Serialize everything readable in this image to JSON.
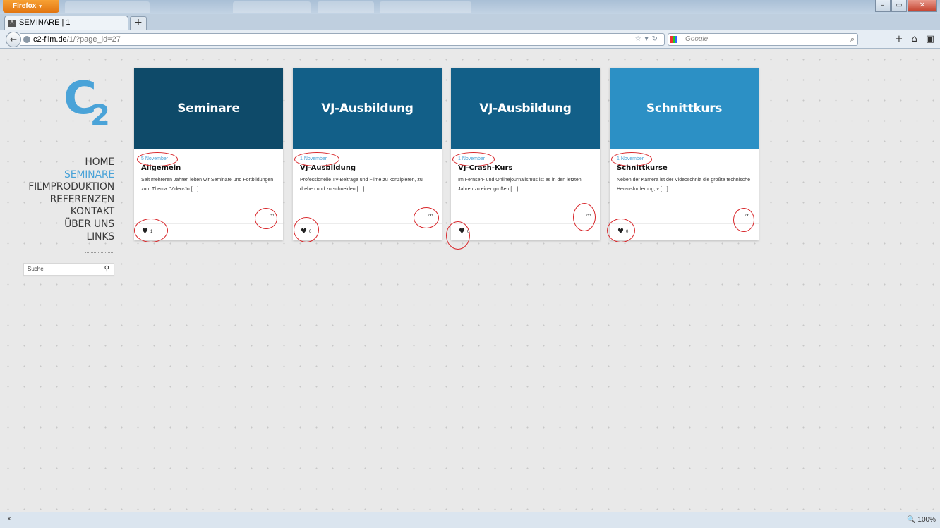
{
  "browser": {
    "menu_label": "Firefox",
    "menu_arrow": "▾",
    "background_tabs": [
      "",
      "",
      "",
      ""
    ],
    "window_controls": {
      "minimize": "–",
      "maximize": "▭",
      "close": "✕"
    },
    "active_tab": {
      "title": "SEMINARE | 1",
      "favicon": "A"
    },
    "new_tab_label": "+",
    "back_icon": "←",
    "url": {
      "host": "c2-film.de",
      "path": "/1/?page_id=27",
      "icons": "☆▾↻"
    },
    "search": {
      "placeholder": "Google",
      "engine_arrow": "▾",
      "icon": "⌕"
    },
    "toolbar_icons": {
      "zoom_out": "–",
      "zoom_in": "+",
      "home": "⌂",
      "menu": "▣"
    }
  },
  "site": {
    "logo": {
      "letter": "C",
      "subscript": "2"
    },
    "nav": [
      {
        "label": "HOME",
        "active": false
      },
      {
        "label": "SEMINARE",
        "active": true
      },
      {
        "label": "FILMPRODUKTION",
        "active": false
      },
      {
        "label": "REFERENZEN",
        "active": false
      },
      {
        "label": "KONTAKT",
        "active": false
      },
      {
        "label": "ÜBER UNS",
        "active": false
      },
      {
        "label": "LINKS",
        "active": false
      }
    ],
    "search": {
      "placeholder": "Suche",
      "icon": "⚲"
    },
    "accent_color": "#4aa3d8"
  },
  "cards": [
    {
      "header": "Seminare",
      "header_color": "#0e4a69",
      "date": "5 November",
      "title": "Allgemein",
      "excerpt": "Seit mehreren Jahren leiten wir Seminare und Fortbildungen zum Thema “Video-Jo […]",
      "heart_icon": "♥",
      "likes": "1",
      "link_icon": "∞"
    },
    {
      "header": "VJ-Ausbildung",
      "header_color": "#125f88",
      "date": "1 November",
      "title": "VJ-Ausbildung",
      "excerpt": "Professionelle TV-Beiträge und Filme zu konzipieren, zu drehen und zu schneiden […]",
      "heart_icon": "♥",
      "likes": "0",
      "link_icon": "∞"
    },
    {
      "header": "VJ-Ausbildung",
      "header_color": "#125f88",
      "date": "1 November",
      "title": "VJ-Crash-Kurs",
      "excerpt": "Im Fernseh- und Onlinejournalismus ist es in den letzten Jahren zu einer großen […]",
      "heart_icon": "♥",
      "likes": "0",
      "link_icon": "∞"
    },
    {
      "header": "Schnittkurs",
      "header_color": "#2c90c5",
      "date": "1 November",
      "title": "Schnittkurse",
      "excerpt": "Neben der Kamera ist der Videoschnitt die größte technische Herausforderung, v […]",
      "heart_icon": "♥",
      "likes": "0",
      "link_icon": "∞"
    }
  ],
  "status": {
    "close_icon": "×",
    "zoom": "100%",
    "zoom_icon": "🔍"
  }
}
